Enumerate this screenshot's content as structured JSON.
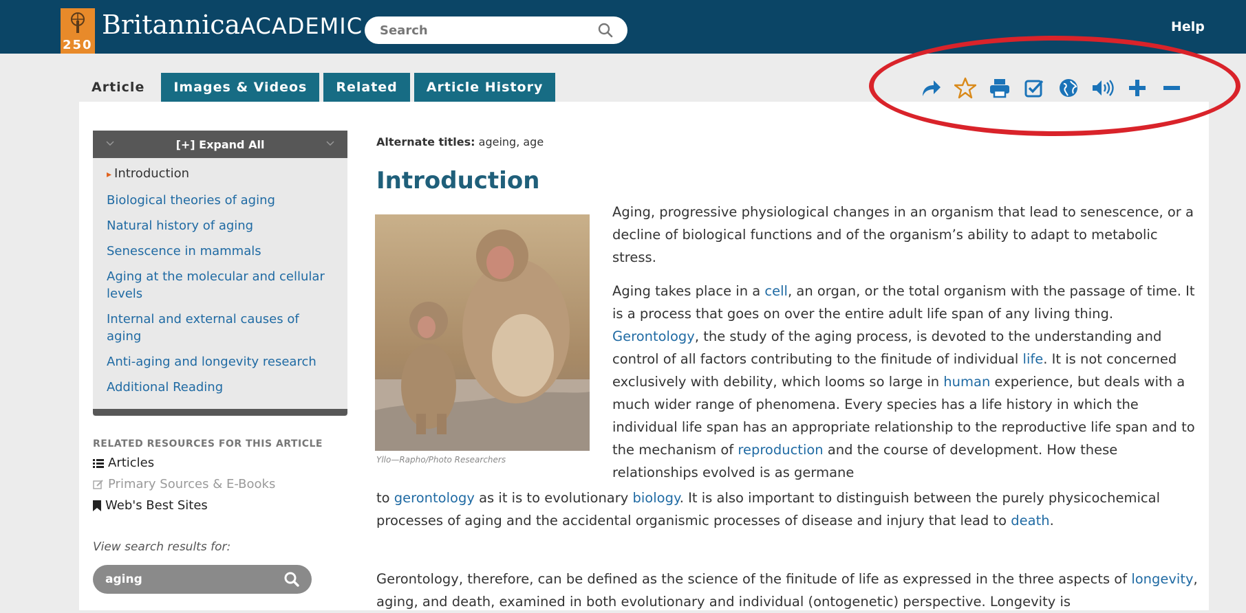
{
  "header": {
    "logo_number": "250",
    "brand_name": "Britannica",
    "brand_suffix": "ACADEMIC",
    "search_placeholder": "Search",
    "help_label": "Help"
  },
  "tabs": [
    {
      "label": "Article",
      "active": true
    },
    {
      "label": "Images & Videos",
      "active": false
    },
    {
      "label": "Related",
      "active": false
    },
    {
      "label": "Article History",
      "active": false
    }
  ],
  "toolbar": {
    "icons": [
      "share-icon",
      "star-icon",
      "print-icon",
      "checkbox-icon",
      "globe-icon",
      "speaker-icon",
      "plus-icon",
      "minus-icon"
    ],
    "color": "#1a73b8",
    "star_color": "#d98a1b"
  },
  "toc": {
    "expand_label": "[+] Expand All",
    "items": [
      "Introduction",
      "Biological theories of aging",
      "Natural history of aging",
      "Senescence in mammals",
      "Aging at the molecular and cellular levels",
      "Internal and external causes of aging",
      "Anti-aging and longevity research",
      "Additional Reading"
    ]
  },
  "related": {
    "title": "RELATED RESOURCES FOR THIS ARTICLE",
    "links": [
      "Articles",
      "Primary Sources & E-Books",
      "Web's Best Sites"
    ],
    "view_search_label": "View search results for:",
    "search_value": "aging"
  },
  "article": {
    "alt_label": "Alternate titles:",
    "alt_value": "ageing, age",
    "heading": "Introduction",
    "caption": "Yllo—Rapho/Photo Researchers",
    "p1": "Aging, progressive physiological changes in an organism that lead to senescence, or a decline of biological functions and of the organism’s ability to adapt to metabolic stress.",
    "p2": {
      "a": "Aging takes place in a ",
      "cell": "cell",
      "b": ", an organ, or the total organism with the passage of time. It is a process that goes on over the entire adult life span of any living thing. ",
      "gerontology": "Gerontology",
      "c": ", the study of the aging process, is devoted to the understanding and control of all factors contributing to the finitude of individual ",
      "life": "life",
      "d": ". It is not concerned exclusively with debility, which looms so large in ",
      "human": "human",
      "e": " experience, but deals with a much wider range of phenomena. Every species has a life history in which the individual life span has an appropriate relationship to the reproductive life span and to the mechanism of ",
      "reproduction": "reproduction",
      "f": " and the course of development. How these relationships evolved is as germane",
      "g": "to ",
      "gerontology2": "gerontology",
      "h": " as it is to evolutionary ",
      "biology": "biology",
      "i": ". It is also important to distinguish between the purely physicochemical processes of aging and the accidental organismic processes of disease and injury that lead to ",
      "death": "death",
      "j": "."
    },
    "p3": {
      "a": "Gerontology, therefore, can be defined as the science of the finitude of life as expressed in the three aspects of ",
      "longevity": "longevity",
      "b": ", aging, and death, examined in both evolutionary and individual (ontogenetic) perspective. Longevity is"
    }
  }
}
